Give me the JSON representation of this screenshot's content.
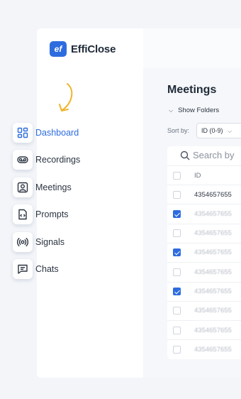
{
  "brand": {
    "logo_mark": "ef",
    "name": "EffiClose"
  },
  "colors": {
    "accent": "#2d6cdf",
    "arrow": "#f0b429",
    "background": "#f3f5f9"
  },
  "sidebar": {
    "items": [
      {
        "label": "Dashboard",
        "icon": "dashboard-icon",
        "active": true
      },
      {
        "label": "Recordings",
        "icon": "voicemail-icon",
        "active": false
      },
      {
        "label": "Meetings",
        "icon": "user-square-icon",
        "active": false
      },
      {
        "label": "Prompts",
        "icon": "code-file-icon",
        "active": false
      },
      {
        "label": "Signals",
        "icon": "broadcast-icon",
        "active": false
      },
      {
        "label": "Chats",
        "icon": "chat-icon",
        "active": false
      }
    ]
  },
  "main": {
    "title": "Meetings",
    "show_folders": "Show Folders",
    "sort_label": "Sort by:",
    "sort_value": "ID (0-9)",
    "search_placeholder": "Search by",
    "table": {
      "header": "ID",
      "rows": [
        {
          "id": "4354657655",
          "checked": false,
          "faded": false
        },
        {
          "id": "4354657655",
          "checked": true,
          "faded": true
        },
        {
          "id": "4354657655",
          "checked": false,
          "faded": true
        },
        {
          "id": "4354657655",
          "checked": true,
          "faded": true
        },
        {
          "id": "4354657655",
          "checked": false,
          "faded": true
        },
        {
          "id": "4354657655",
          "checked": true,
          "faded": true
        },
        {
          "id": "4354657655",
          "checked": false,
          "faded": true
        },
        {
          "id": "4354657655",
          "checked": false,
          "faded": true
        },
        {
          "id": "4354657655",
          "checked": false,
          "faded": true
        }
      ]
    }
  }
}
